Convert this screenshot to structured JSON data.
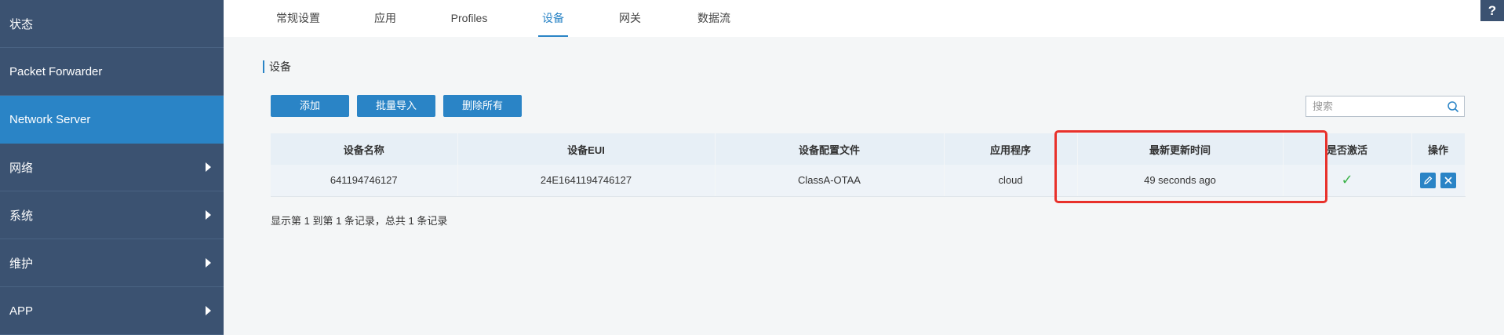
{
  "sidebar": {
    "items": [
      {
        "label": "状态",
        "has_submenu": false,
        "active": false
      },
      {
        "label": "Packet Forwarder",
        "has_submenu": false,
        "active": false
      },
      {
        "label": "Network Server",
        "has_submenu": false,
        "active": true
      },
      {
        "label": "网络",
        "has_submenu": true,
        "active": false
      },
      {
        "label": "系统",
        "has_submenu": true,
        "active": false
      },
      {
        "label": "维护",
        "has_submenu": true,
        "active": false
      },
      {
        "label": "APP",
        "has_submenu": true,
        "active": false
      }
    ]
  },
  "tabs": [
    {
      "label": "常规设置",
      "active": false
    },
    {
      "label": "应用",
      "active": false
    },
    {
      "label": "Profiles",
      "active": false
    },
    {
      "label": "设备",
      "active": true
    },
    {
      "label": "网关",
      "active": false
    },
    {
      "label": "数据流",
      "active": false
    }
  ],
  "help": {
    "label": "?"
  },
  "section": {
    "title": "设备"
  },
  "toolbar": {
    "add_label": "添加",
    "bulk_import_label": "批量导入",
    "delete_all_label": "删除所有"
  },
  "search": {
    "placeholder": "搜索",
    "value": ""
  },
  "table": {
    "columns": [
      "设备名称",
      "设备EUI",
      "设备配置文件",
      "应用程序",
      "最新更新时间",
      "是否激活",
      "操作"
    ],
    "rows": [
      {
        "name": "641194746127",
        "eui": "24E1641194746127",
        "profile": "ClassA-OTAA",
        "application": "cloud",
        "last_update": "49 seconds ago",
        "activated": true
      }
    ]
  },
  "footer": {
    "info": "显示第 1 到第 1 条记录，总共 1 条记录"
  },
  "colors": {
    "sidebar_bg": "#3b5271",
    "accent": "#2a84c6",
    "highlight": "#e8312b",
    "check": "#3cb34a"
  }
}
